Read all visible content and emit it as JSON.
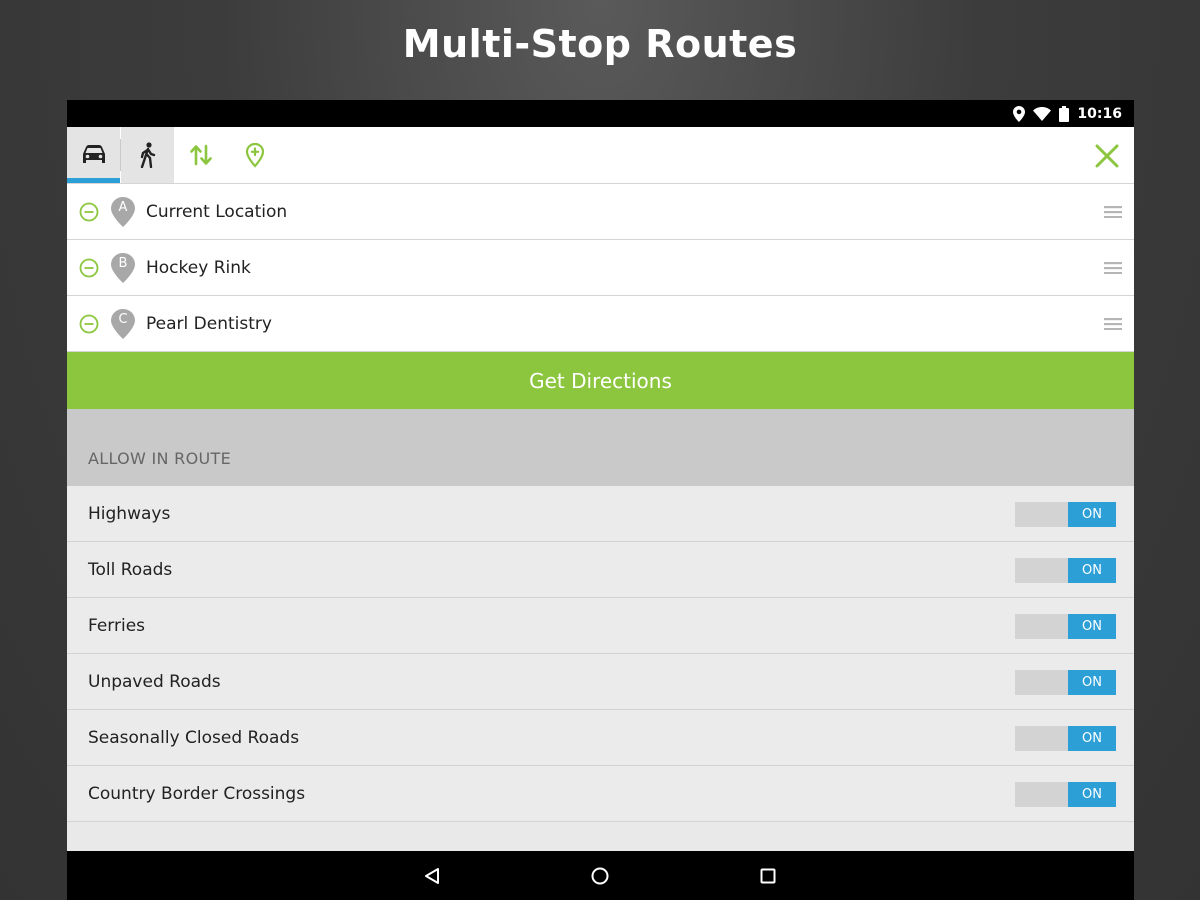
{
  "headline": "Multi-Stop Routes",
  "status": {
    "time": "10:16"
  },
  "toolbar": {
    "modes": [
      {
        "name": "car-mode",
        "icon": "car-icon",
        "active": true
      },
      {
        "name": "walk-mode",
        "icon": "walking-person-icon",
        "active": false
      }
    ],
    "tools": [
      "swap-arrows-icon",
      "add-location-pin-icon"
    ],
    "close_icon": "close-icon"
  },
  "stops": [
    {
      "letter": "A",
      "label": "Current Location"
    },
    {
      "letter": "B",
      "label": "Hockey Rink"
    },
    {
      "letter": "C",
      "label": "Pearl Dentistry"
    }
  ],
  "get_directions": "Get Directions",
  "allow_section": {
    "header": "ALLOW IN ROUTE",
    "options": [
      {
        "label": "Highways",
        "state": "ON"
      },
      {
        "label": "Toll Roads",
        "state": "ON"
      },
      {
        "label": "Ferries",
        "state": "ON"
      },
      {
        "label": "Unpaved Roads",
        "state": "ON"
      },
      {
        "label": "Seasonally Closed Roads",
        "state": "ON"
      },
      {
        "label": "Country Border Crossings",
        "state": "ON"
      }
    ]
  },
  "colors": {
    "accent_green": "#8cc63f",
    "accent_blue": "#2c9fd6"
  }
}
